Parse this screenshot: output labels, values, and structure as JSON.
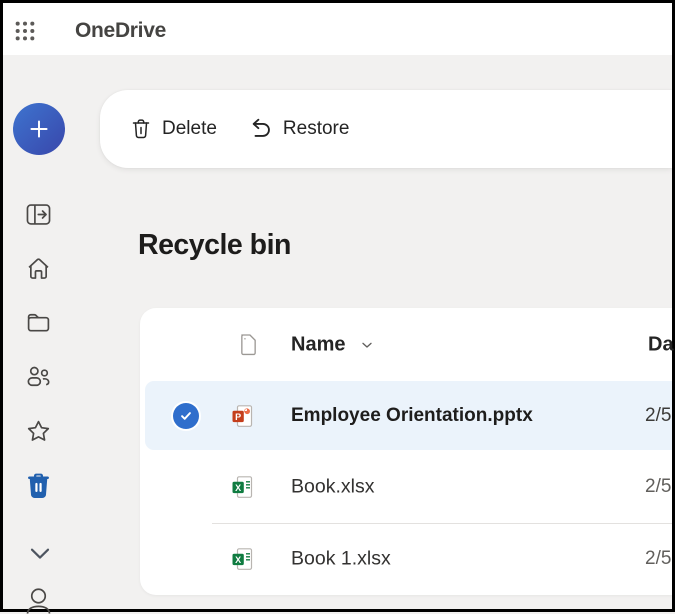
{
  "app": {
    "title": "OneDrive"
  },
  "toolbar": {
    "delete_label": "Delete",
    "restore_label": "Restore"
  },
  "main": {
    "title": "Recycle bin"
  },
  "table": {
    "name_header": "Name",
    "date_header": "Da",
    "rows": [
      {
        "name": "Employee Orientation.pptx",
        "date": "2/5",
        "file_type": "powerpoint",
        "selected": true
      },
      {
        "name": "Book.xlsx",
        "date": "2/5",
        "file_type": "excel",
        "selected": false
      },
      {
        "name": "Book 1.xlsx",
        "date": "2/5",
        "file_type": "excel",
        "selected": false
      }
    ]
  },
  "sidebar": {
    "items": [
      {
        "icon": "panel-expand"
      },
      {
        "icon": "home"
      },
      {
        "icon": "folder"
      },
      {
        "icon": "people"
      },
      {
        "icon": "star"
      },
      {
        "icon": "trash",
        "active": true
      },
      {
        "icon": "chevron-down"
      },
      {
        "icon": "person"
      }
    ]
  },
  "colors": {
    "background": "#f2f1f0",
    "selection_row_bg": "#ebf3fb",
    "check_circle": "#2f6ecc",
    "sidebar_active": "#2160ae",
    "plus_gradient_start": "#3e74cf",
    "plus_gradient_end": "#3a49ac",
    "powerpoint": "#c43e1c",
    "excel": "#107c41"
  }
}
